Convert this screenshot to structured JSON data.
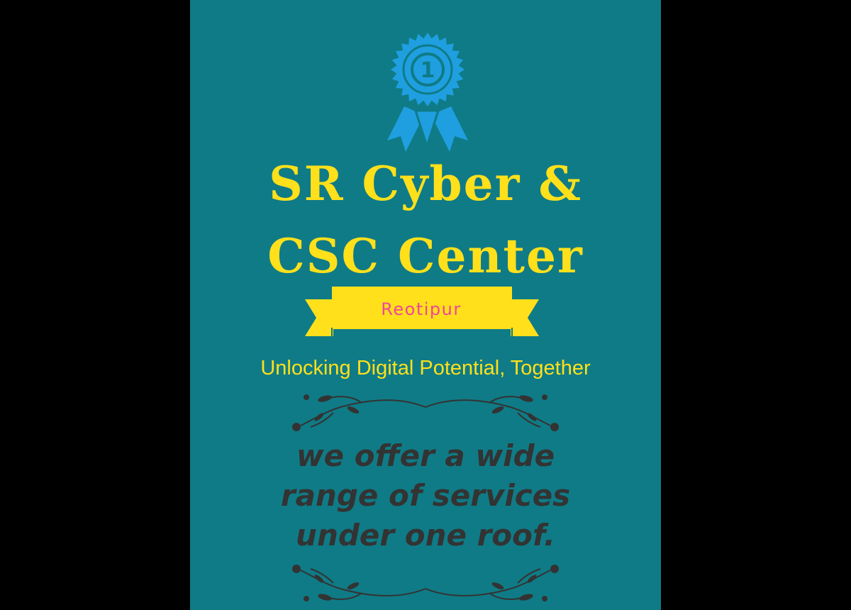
{
  "poster": {
    "badge_number": "1",
    "title_line1": "SR Cyber &",
    "title_line2": "CSC Center",
    "location": "Reotipur",
    "tagline": "Unlocking Digital Potential, Together",
    "body_lines": [
      "we offer a wide",
      "range of services",
      "under one roof."
    ]
  },
  "colors": {
    "background": "#000000",
    "poster_background": "#0f7b86",
    "title": "#ffe01b",
    "banner": "#ffe01b",
    "banner_text": "#f0469a",
    "badge": "#1f9fe0",
    "body_text": "#333333"
  },
  "icons": {
    "badge": "award-ribbon-icon",
    "ornaments": "floral-divider-icon"
  }
}
